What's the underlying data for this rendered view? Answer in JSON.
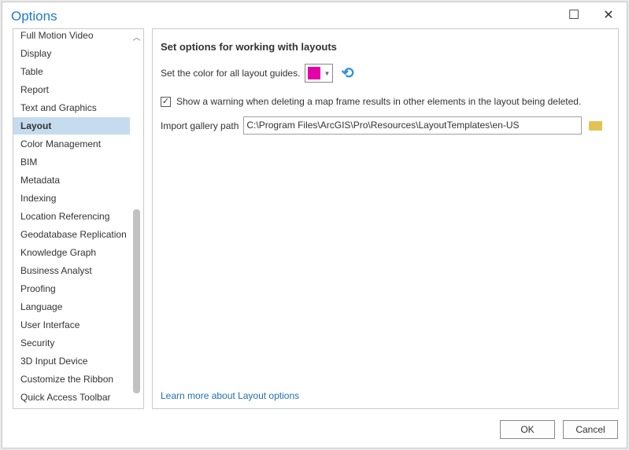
{
  "title": "Options",
  "sidebar": {
    "items": [
      "Full Motion Video",
      "Display",
      "Table",
      "Report",
      "Text and Graphics",
      "Layout",
      "Color Management",
      "BIM",
      "Metadata",
      "Indexing",
      "Location Referencing",
      "Geodatabase Replication",
      "Knowledge Graph",
      "Business Analyst",
      "Proofing",
      "Language",
      "User Interface",
      "Security",
      "3D Input Device",
      "Customize the Ribbon",
      "Quick Access Toolbar"
    ],
    "selected": "Layout"
  },
  "main": {
    "heading": "Set options for working with layouts",
    "color_label": "Set the color for all layout guides.",
    "guide_color": "#e600a9",
    "warning_label": "Show a warning when deleting a map frame results in other elements in the layout being deleted.",
    "warning_checked": true,
    "gallery_label": "Import gallery path",
    "gallery_path": "C:\\Program Files\\ArcGIS\\Pro\\Resources\\LayoutTemplates\\en-US",
    "learn_more": "Learn more about Layout options"
  },
  "buttons": {
    "ok": "OK",
    "cancel": "Cancel"
  }
}
